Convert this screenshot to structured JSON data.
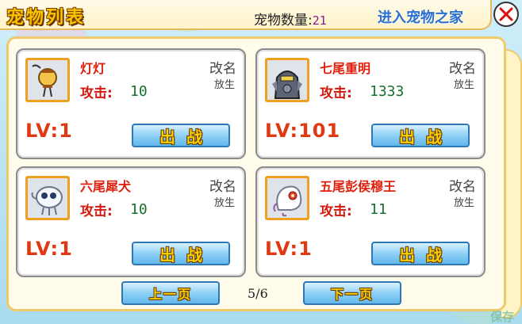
{
  "header": {
    "title": "宠物列表",
    "count_label": "宠物数量:",
    "count_value": "21",
    "home_link": "进入宠物之家"
  },
  "labels": {
    "rename": "改名",
    "release": "放生",
    "attack": "攻击:",
    "battle": "出战"
  },
  "pets": [
    {
      "name": "灯灯",
      "attack": "10",
      "level": "LV:1",
      "avatar_icon": "lantern-pet-icon"
    },
    {
      "name": "七尾重明",
      "attack": "1333",
      "level": "LV:101",
      "avatar_icon": "armored-knight-pet-icon"
    },
    {
      "name": "六尾犀犬",
      "attack": "10",
      "level": "LV:1",
      "avatar_icon": "white-puffball-pet-icon"
    },
    {
      "name": "五尾彭侯穆王",
      "attack": "11",
      "level": "LV:1",
      "avatar_icon": "white-spirit-pet-icon"
    }
  ],
  "pagination": {
    "prev_label": "上一页",
    "next_label": "下一页",
    "indicator": "5/6"
  },
  "corner_text": "保存",
  "colors": {
    "accent_border": "#efc96a",
    "name_red": "#e0200e",
    "attack_green": "#16702c",
    "button_blue": "#8fd0f5"
  }
}
